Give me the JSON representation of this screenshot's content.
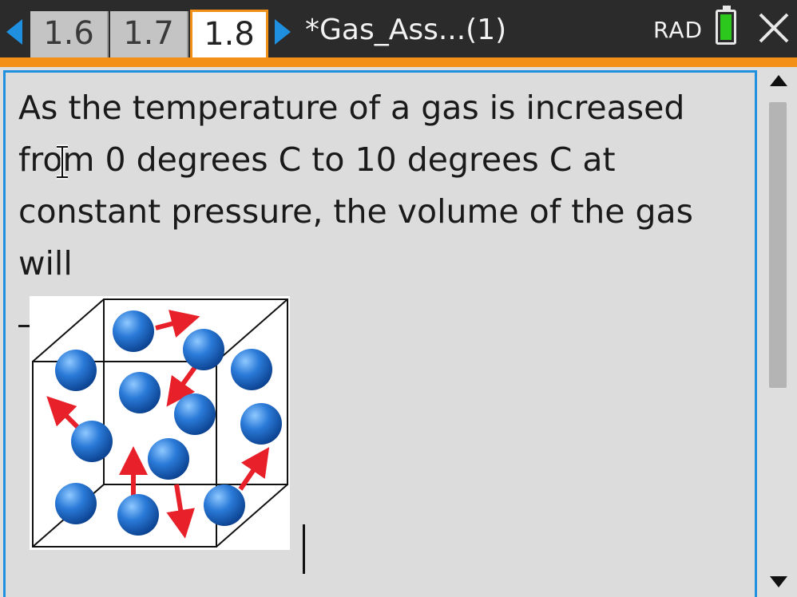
{
  "header": {
    "tabs": [
      {
        "label": "1.6",
        "active": false
      },
      {
        "label": "1.7",
        "active": false
      },
      {
        "label": "1.8",
        "active": true
      }
    ],
    "document_title": "*Gas_Ass...(1)",
    "angle_mode": "RAD",
    "battery_level": 1.0
  },
  "colors": {
    "accent_orange": "#f39018",
    "accent_blue": "#1f8fe0",
    "battery_green": "#2dc81e",
    "molecule_blue": "#1565c0",
    "arrow_red": "#e8202a"
  },
  "question": {
    "text": "As the temperature of a gas is increased from 0 degrees C to 10 degrees C at constant pressure, the volume of the gas will",
    "blank_suffix": "."
  },
  "icons": {
    "prev": "triangle-left-icon",
    "next": "triangle-right-icon",
    "battery": "battery-icon",
    "close": "close-x-icon",
    "cursor": "ibeam-cursor-icon"
  }
}
